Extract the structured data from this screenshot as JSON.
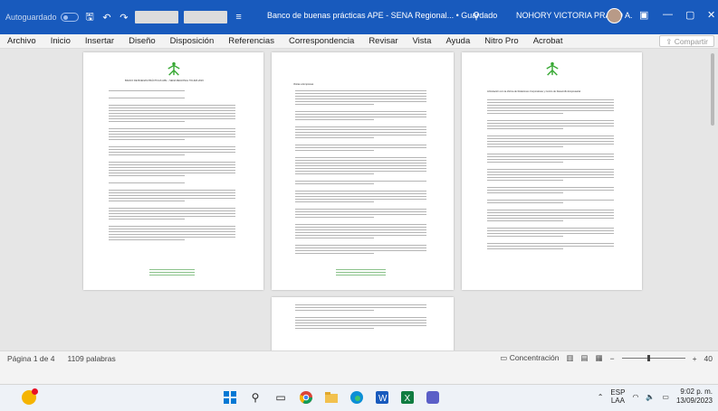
{
  "titlebar": {
    "autosave_label": "Autoguardado",
    "document_title": "Banco de buenas prácticas APE - SENA Regional... • Guardado",
    "user_name": "NOHORY VICTORIA PRADO A.",
    "minimize_glyph": "—",
    "restore_glyph": "▢",
    "close_glyph": "✕"
  },
  "ribbon": {
    "tabs": [
      "Archivo",
      "Inicio",
      "Insertar",
      "Diseño",
      "Disposición",
      "Referencias",
      "Correspondencia",
      "Revisar",
      "Vista",
      "Ayuda",
      "Nitro Pro",
      "Acrobat"
    ],
    "share_label": "Compartir"
  },
  "document": {
    "page1_heading": "BANCO DE BUENAS PRÁCTICAS APE – SENA REGIONAL TOLIMA 2023",
    "page2_heading": "Visitas a Empresas",
    "page3_heading": "Articulación con la oficina de Relaciones Corporativas y Centro de Desarrollo Empresarial"
  },
  "statusbar": {
    "page_info": "Página 1 de 4",
    "word_count": "1109 palabras",
    "focus_label": "Concentración",
    "zoom_level": "40"
  },
  "taskbar": {
    "lang_line1": "ESP",
    "lang_line2": "LAA",
    "time": "9:02 p. m.",
    "date": "13/09/2023"
  },
  "colors": {
    "word_blue": "#185abd",
    "sena_green": "#39a935"
  }
}
